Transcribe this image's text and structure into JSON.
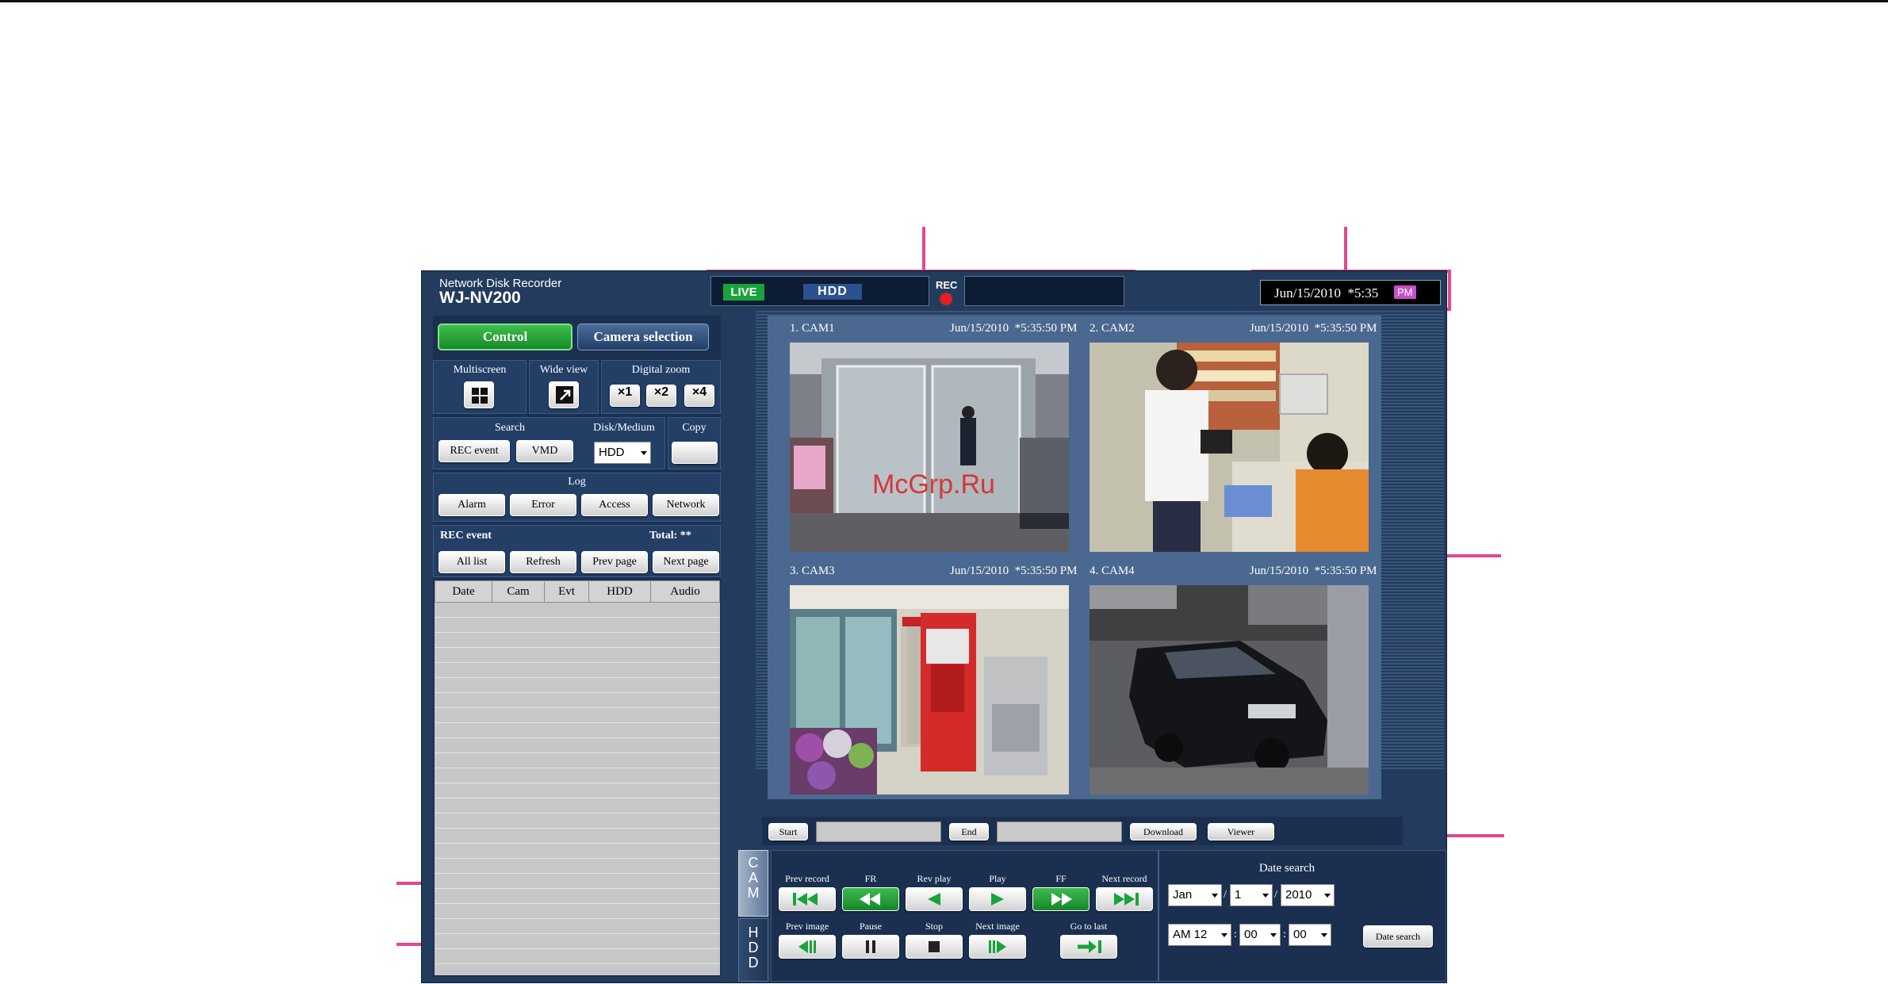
{
  "app": {
    "brand_line1": "Network Disk Recorder",
    "brand_model": "WJ-NV200"
  },
  "header": {
    "live_badge": "LIVE",
    "hdd_badge": "HDD",
    "rec_label": "REC",
    "date_time": "Jun/15/2010  *5:35",
    "ampm": "PM"
  },
  "tabs": {
    "control": "Control",
    "camera_selection": "Camera selection"
  },
  "display": {
    "multiscreen": "Multiscreen",
    "wide_view": "Wide view",
    "digital_zoom": "Digital zoom",
    "zoom_x1": "×1",
    "zoom_x2": "×2",
    "zoom_x4": "×4"
  },
  "search": {
    "label": "Search",
    "rec_event": "REC event",
    "vmd": "VMD",
    "disk_label": "Disk/Medium",
    "disk_value": "HDD",
    "copy_label": "Copy"
  },
  "log": {
    "label": "Log",
    "alarm": "Alarm",
    "error": "Error",
    "access": "Access",
    "network": "Network"
  },
  "rec_event": {
    "title": "REC event",
    "total": "Total: **",
    "all_list": "All list",
    "refresh": "Refresh",
    "prev_page": "Prev page",
    "next_page": "Next page",
    "columns": [
      "Date",
      "Cam",
      "Evt",
      "HDD",
      "Audio"
    ]
  },
  "cameras": [
    {
      "name": "1. CAM1",
      "time": "Jun/15/2010  *5:35:50 PM"
    },
    {
      "name": "2. CAM2",
      "time": "Jun/15/2010  *5:35:50 PM"
    },
    {
      "name": "3. CAM3",
      "time": "Jun/15/2010  *5:35:50 PM"
    },
    {
      "name": "4. CAM4",
      "time": "Jun/15/2010  *5:35:50 PM"
    }
  ],
  "watermark": "McGrp.Ru",
  "download": {
    "start": "Start",
    "end": "End",
    "download": "Download",
    "viewer": "Viewer"
  },
  "side_tabs": {
    "cam": "C A M",
    "hdd": "H D D"
  },
  "playback": {
    "prev_record": "Prev record",
    "fr": "FR",
    "rev_play": "Rev play",
    "play": "Play",
    "ff": "FF",
    "next_record": "Next record",
    "prev_image": "Prev image",
    "pause": "Pause",
    "stop": "Stop",
    "next_image": "Next image",
    "go_to_last": "Go to last"
  },
  "date_search": {
    "label": "Date search",
    "month": "Jan",
    "day": "1",
    "year": "2010",
    "hour": "AM 12",
    "minute": "00",
    "second": "00",
    "slash": "/",
    "colon": ":",
    "button": "Date search"
  },
  "colors": {
    "callout": "#e0498f",
    "panel": "#233b5c",
    "live_green": "#1aa23c",
    "control_tab": "#178a28",
    "play_green": "#1aa23c"
  }
}
